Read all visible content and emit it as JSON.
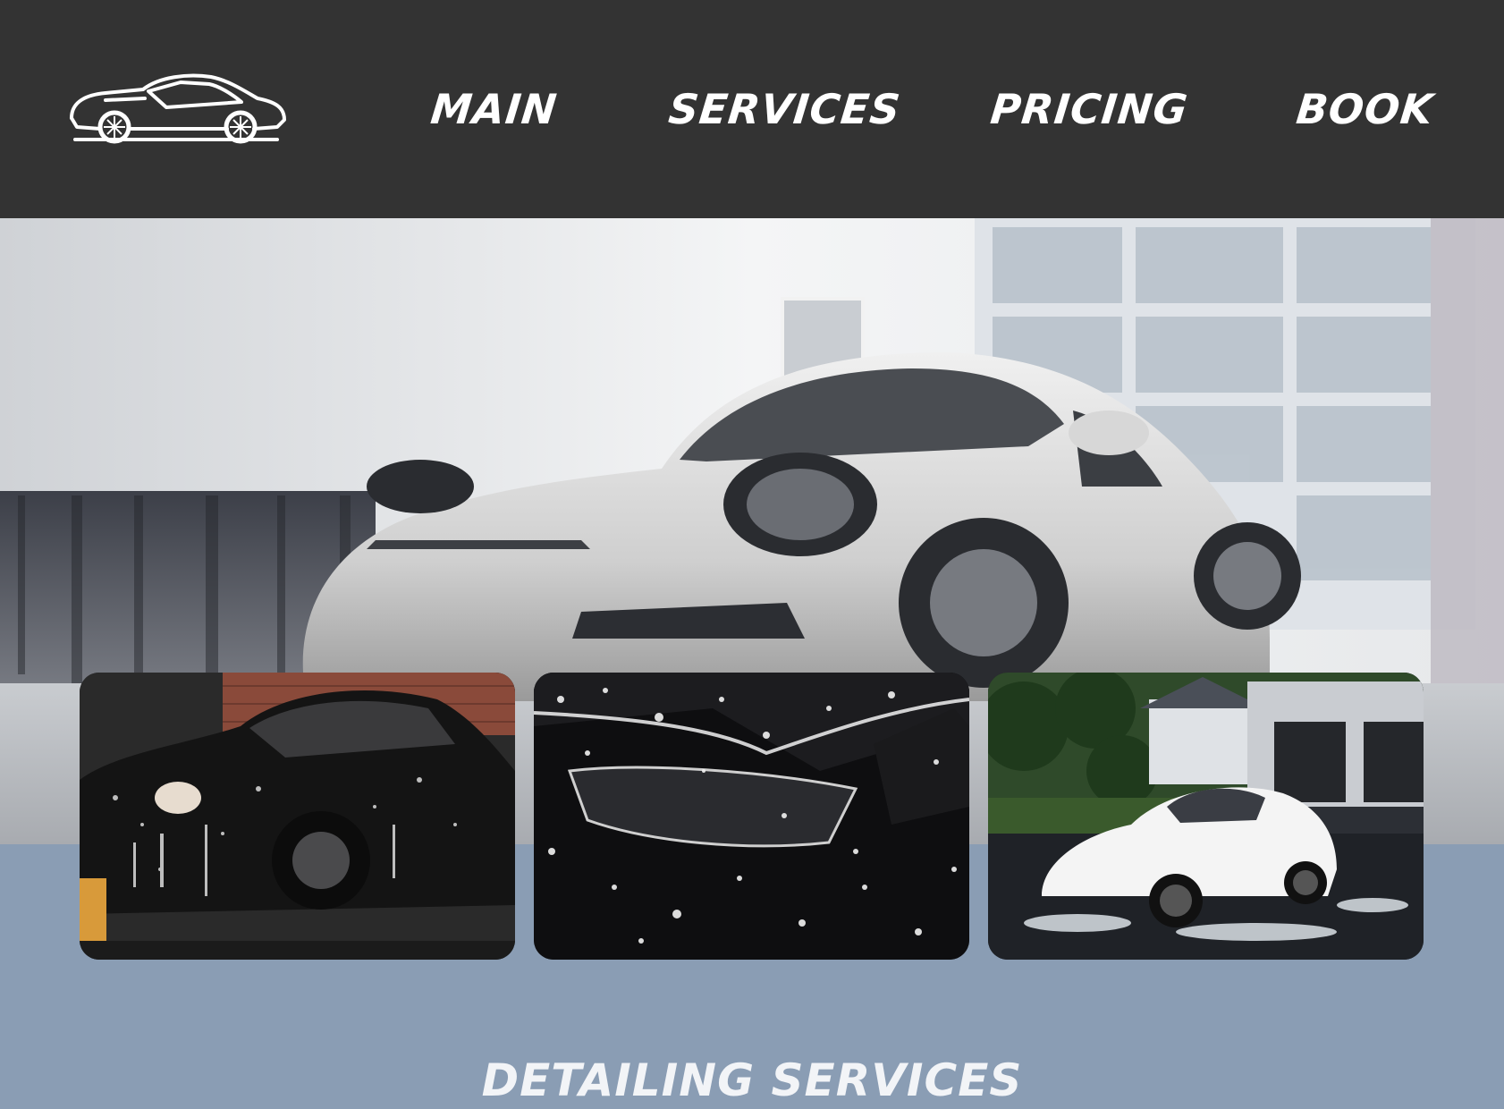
{
  "nav": {
    "logo_icon": "sports-car-icon",
    "items": [
      {
        "label": "MAIN"
      },
      {
        "label": "SERVICES"
      },
      {
        "label": "PRICING"
      },
      {
        "label": "BOOK"
      }
    ]
  },
  "colors": {
    "header_bg": "#333333",
    "page_bg": "#8a9db4",
    "nav_text": "#ffffff"
  },
  "hero": {
    "image": "white-sports-car-in-wash-garage"
  },
  "gallery": [
    {
      "image": "black-car-being-hand-washed"
    },
    {
      "image": "foam-covered-headlight-closeup"
    },
    {
      "image": "white-coupe-foamed-in-driveway"
    }
  ],
  "section": {
    "title": "DETAILING SERVICES"
  }
}
